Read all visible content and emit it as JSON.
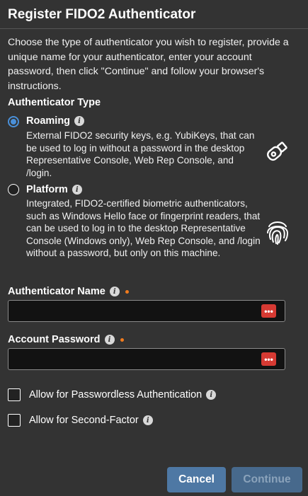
{
  "dialog": {
    "title": "Register FIDO2 Authenticator",
    "intro": "Choose the type of authenticator you wish to register, provide a unique name for your authenticator, enter your account password, then click \"Continue\" and follow your browser's instructions."
  },
  "authenticator_type": {
    "label": "Authenticator Type",
    "selected": "roaming",
    "options": [
      {
        "id": "roaming",
        "title": "Roaming",
        "description": "External FIDO2 security keys, e.g. YubiKeys, that can be used to log in without a password in the desktop Representative Console, Web Rep Console, and /login.",
        "icon": "usb-key-icon"
      },
      {
        "id": "platform",
        "title": "Platform",
        "description": "Integrated, FIDO2-certified biometric authenticators, such as Windows Hello face or fingerprint readers, that can be used to log in to the desktop Representative Console (Windows only), Web Rep Console, and /login without a password, but only on this machine.",
        "icon": "fingerprint-icon"
      }
    ]
  },
  "fields": {
    "name_label": "Authenticator Name",
    "name_value": "",
    "password_label": "Account Password",
    "password_value": "",
    "password_manager_glyph": "•••"
  },
  "checkboxes": {
    "passwordless_label": "Allow for Passwordless Authentication",
    "passwordless_checked": false,
    "second_factor_label": "Allow for Second-Factor",
    "second_factor_checked": false
  },
  "buttons": {
    "cancel": "Cancel",
    "continue": "Continue",
    "continue_enabled": false
  },
  "icons": {
    "info": "i"
  },
  "colors": {
    "background": "#333333",
    "accent": "#4a90d9",
    "required": "#f07b1e",
    "pw_manager": "#d63a33",
    "cancel_bg": "#4e78a4",
    "continue_bg": "#47698c"
  }
}
